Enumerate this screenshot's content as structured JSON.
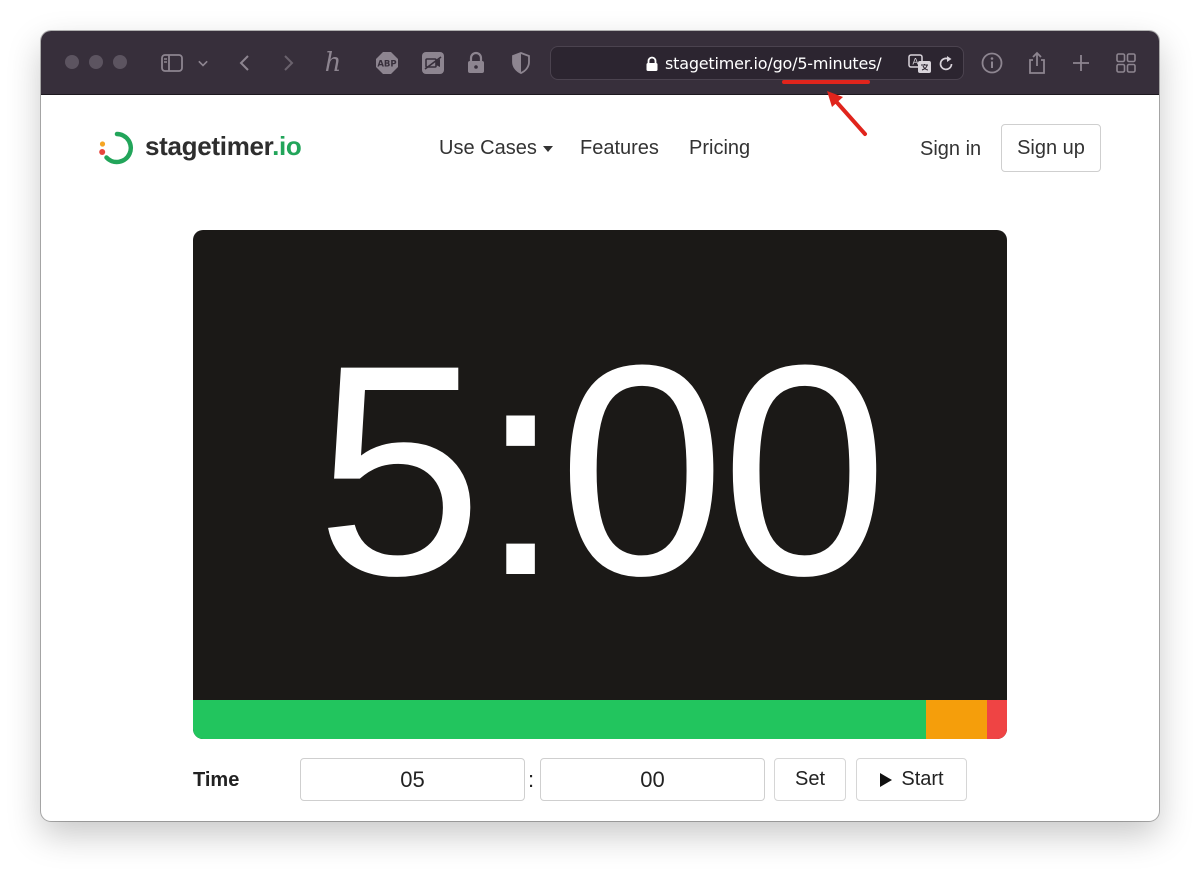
{
  "browser": {
    "url": "stagetimer.io/go/5-minutes/",
    "icons": [
      "sidebar-icon",
      "chevron-down-icon",
      "back-icon",
      "forward-icon",
      "honey-extension-icon",
      "adblock-icon",
      "video-extension-icon",
      "lock-extension-icon",
      "shield-icon",
      "translate-icon",
      "reload-icon",
      "info-icon",
      "share-icon",
      "new-tab-icon",
      "tab-overview-icon"
    ],
    "abp_label": "ABP",
    "honey_label": "h"
  },
  "header": {
    "logo_name": "stagetimer",
    "logo_tld": ".io",
    "nav": [
      "Use Cases",
      "Features",
      "Pricing"
    ],
    "signin_label": "Sign in",
    "signup_label": "Sign up"
  },
  "timer": {
    "display": "5:00",
    "progress_segments": [
      {
        "color": "#22c55e",
        "fraction": 0.9
      },
      {
        "color": "#f59e0b",
        "fraction": 0.075
      },
      {
        "color": "#ef4444",
        "fraction": 0.025
      }
    ]
  },
  "controls": {
    "time_label": "Time",
    "minutes_value": "05",
    "separator": ":",
    "seconds_value": "00",
    "set_label": "Set",
    "start_label": "Start"
  },
  "colors": {
    "brand_green": "#22a55a",
    "toolbar_bg": "#372f3b",
    "annotation_red": "#e0241c"
  }
}
